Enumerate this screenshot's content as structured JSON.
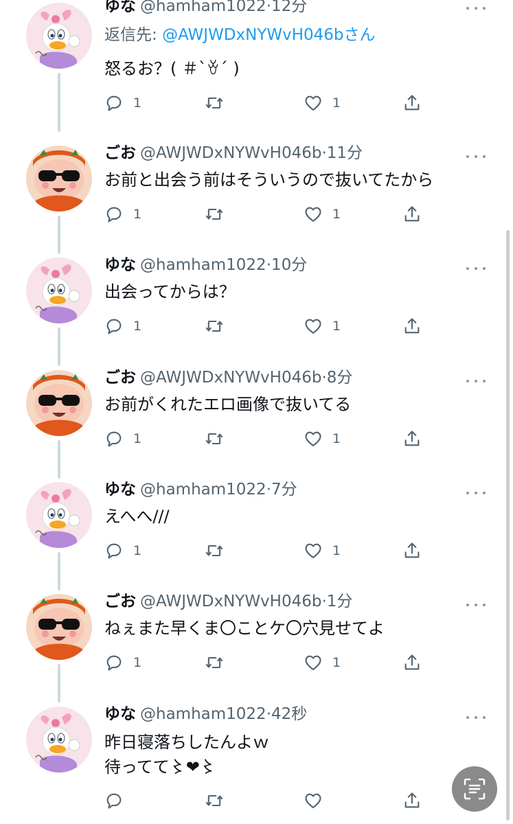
{
  "colors": {
    "text": "#0f1419",
    "secondary": "#536471",
    "link": "#1d9bf0",
    "thread_line": "#cfd9de"
  },
  "tweets": [
    {
      "name": "ゆな",
      "handle": "@hamham1022",
      "sep": "·",
      "time": "12分",
      "reply_label": "返信先: ",
      "reply_mention": "@AWJWDxNYWvH046b",
      "reply_suffix": "さん",
      "text": "怒るお？( ＃`ꈊ´ )",
      "replies": "1",
      "retweets": "",
      "likes": "1",
      "avatar": "daisy-duck-avatar"
    },
    {
      "name": "ごお",
      "handle": "@AWJWDxNYWvH046b",
      "sep": "·",
      "time": "11分",
      "text": "お前と出会う前はそういうので抜いてたから",
      "replies": "1",
      "retweets": "",
      "likes": "1",
      "avatar": "sunglasses-character-avatar"
    },
    {
      "name": "ゆな",
      "handle": "@hamham1022",
      "sep": "·",
      "time": "10分",
      "text": "出会ってからは？",
      "replies": "1",
      "retweets": "",
      "likes": "1",
      "avatar": "daisy-duck-avatar"
    },
    {
      "name": "ごお",
      "handle": "@AWJWDxNYWvH046b",
      "sep": "·",
      "time": "8分",
      "text": "お前がくれたエロ画像で抜いてる",
      "replies": "1",
      "retweets": "",
      "likes": "1",
      "avatar": "sunglasses-character-avatar"
    },
    {
      "name": "ゆな",
      "handle": "@hamham1022",
      "sep": "·",
      "time": "7分",
      "text": "えへへ///",
      "replies": "1",
      "retweets": "",
      "likes": "1",
      "avatar": "daisy-duck-avatar"
    },
    {
      "name": "ごお",
      "handle": "@AWJWDxNYWvH046b",
      "sep": "·",
      "time": "1分",
      "text": "ねぇまた早くま〇ことケ〇穴見せてよ",
      "replies": "1",
      "retweets": "",
      "likes": "1",
      "avatar": "sunglasses-character-avatar"
    },
    {
      "name": "ゆな",
      "handle": "@hamham1022",
      "sep": "·",
      "time": "42秒",
      "text_line1": "昨日寝落ちしたんよｗ",
      "text_line2": "待ってて〻❤︎〻",
      "replies": "",
      "retweets": "",
      "likes": "",
      "avatar": "daisy-duck-avatar"
    }
  ]
}
